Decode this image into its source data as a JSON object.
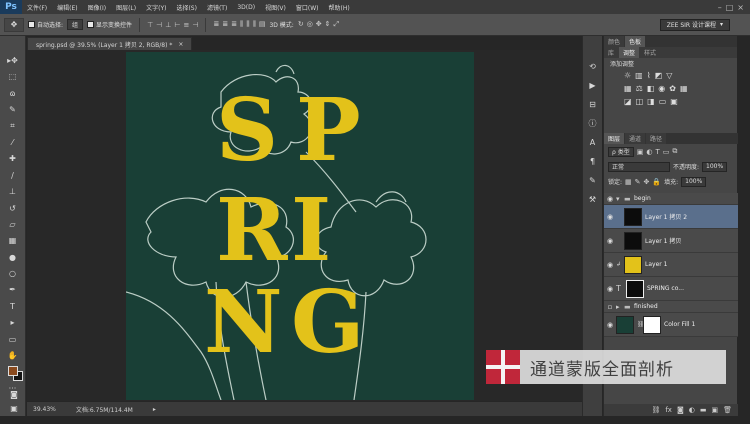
{
  "app": {
    "logo": "Ps"
  },
  "menu": [
    "文件(F)",
    "编辑(E)",
    "图像(I)",
    "图层(L)",
    "文字(Y)",
    "选择(S)",
    "滤镜(T)",
    "3D(D)",
    "视图(V)",
    "窗口(W)",
    "帮助(H)"
  ],
  "options": {
    "auto_select": "自动选择:",
    "auto_select_value": "组",
    "show_transform": "显示变换控件",
    "mode3d": "3D 模式:",
    "workspace": "ZEE SIR 设计课程"
  },
  "document": {
    "tab_title": "spring.psd @ 39.5% (Layer 1 拷贝 2, RGB/8) *",
    "close": "×"
  },
  "canvas": {
    "letters": [
      "S",
      "P",
      "R",
      "I",
      "N",
      "G"
    ],
    "background": "#193f36",
    "letter_color": "#e3c21a"
  },
  "status": {
    "zoom": "39.43%",
    "doc_info": "文档:6.75M/114.4M"
  },
  "panels": {
    "top_tabs": [
      "颜色",
      "色板"
    ],
    "mid_tabs": [
      "库",
      "调整",
      "样式"
    ],
    "adj_title": "添加调整",
    "layer_tabs": [
      "图层",
      "通道",
      "路径"
    ],
    "filter_kind": "ρ 类型",
    "blend_mode": "正常",
    "opacity_label": "不透明度:",
    "opacity_value": "100%",
    "lock_label": "锁定:",
    "fill_label": "填充:",
    "fill_value": "100%"
  },
  "layers": [
    {
      "name": "begin",
      "type": "group"
    },
    {
      "name": "Layer 1 拷贝 2",
      "type": "layer",
      "selected": true
    },
    {
      "name": "Layer 1 拷贝",
      "type": "layer"
    },
    {
      "name": "Layer 1",
      "type": "layer"
    },
    {
      "name": "SPRING co...",
      "type": "text"
    },
    {
      "name": "finished",
      "type": "group"
    },
    {
      "name": "Color Fill 1",
      "type": "fill"
    }
  ],
  "watermark": {
    "text": "通道蒙版全面剖析"
  }
}
